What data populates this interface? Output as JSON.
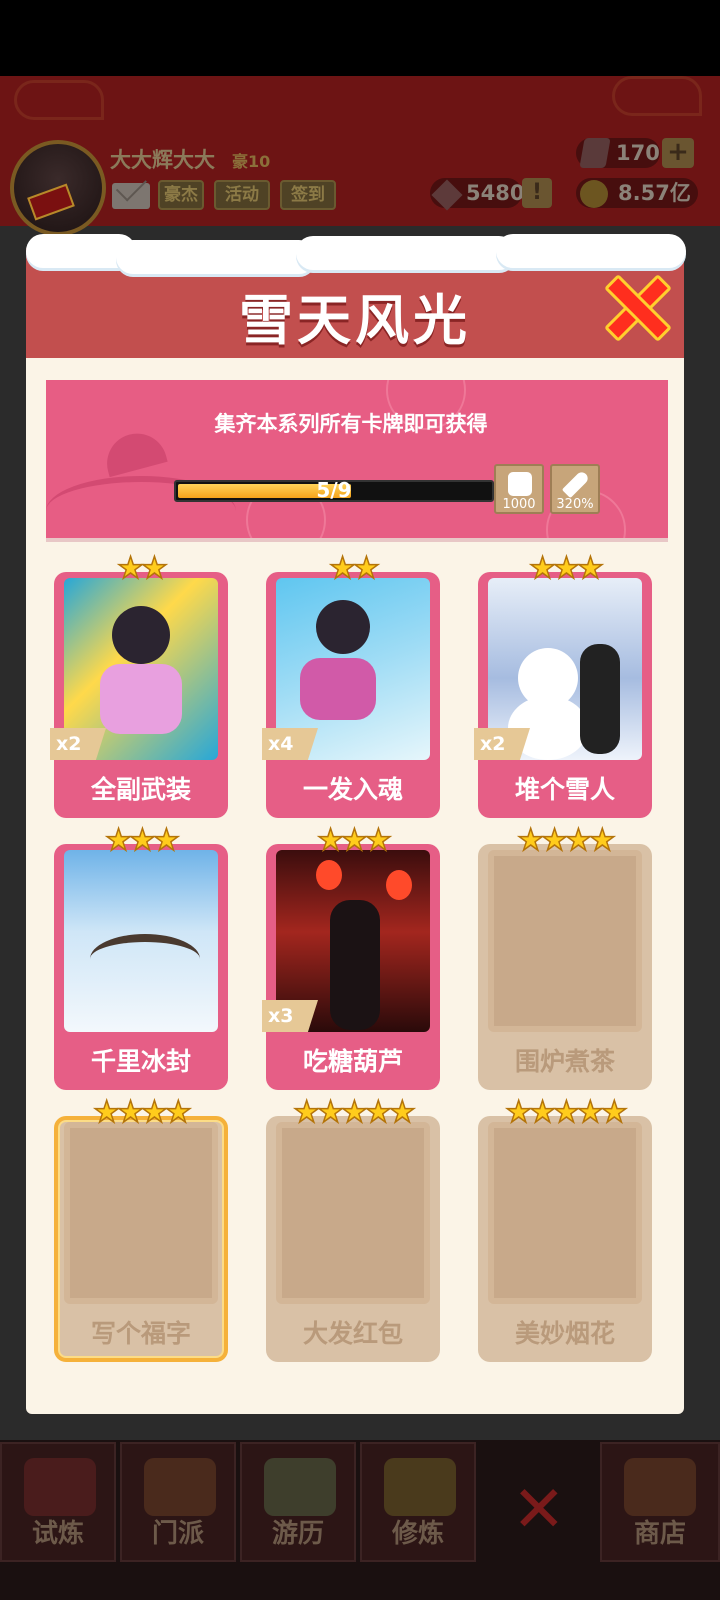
{
  "player": {
    "name": "大大辉大大",
    "vip": "豪10",
    "gems": "170",
    "crystals": "5480",
    "coins": "8.57亿"
  },
  "header_buttons": [
    "豪杰",
    "活动",
    "签到"
  ],
  "plus_label": "+",
  "alert_label": "!",
  "modal": {
    "title": "雪天风光",
    "banner_text": "集齐本系列所有卡牌即可获得",
    "progress_text": "5/9",
    "progress_fraction": 0.5556,
    "rewards": [
      {
        "icon": "dice-icon",
        "label": "1000"
      },
      {
        "icon": "blade-icon",
        "label": "320%"
      }
    ]
  },
  "cards": [
    {
      "name": "全副武装",
      "stars": "★★",
      "count": "x2",
      "owned": true
    },
    {
      "name": "一发入魂",
      "stars": "★★",
      "count": "x4",
      "owned": true
    },
    {
      "name": "堆个雪人",
      "stars": "★★★",
      "count": "x2",
      "owned": true
    },
    {
      "name": "千里冰封",
      "stars": "★★★",
      "count": "",
      "owned": true
    },
    {
      "name": "吃糖葫芦",
      "stars": "★★★",
      "count": "x3",
      "owned": true
    },
    {
      "name": "围炉煮茶",
      "stars": "★★★★",
      "count": "",
      "owned": false
    },
    {
      "name": "写个福字",
      "stars": "★★★★",
      "count": "",
      "owned": false
    },
    {
      "name": "大发红包",
      "stars": "★★★★★",
      "count": "",
      "owned": false
    },
    {
      "name": "美妙烟花",
      "stars": "★★★★★",
      "count": "",
      "owned": false
    }
  ],
  "nav": [
    "试炼",
    "门派",
    "游历",
    "修炼",
    "",
    "商店"
  ],
  "nav_close": "✕",
  "colors": {
    "modal_header": "#c24f4e",
    "banner": "#e75d84",
    "card_frame": "#e65e86",
    "star": "#ffcc1c",
    "close": "#ff2e1e"
  }
}
